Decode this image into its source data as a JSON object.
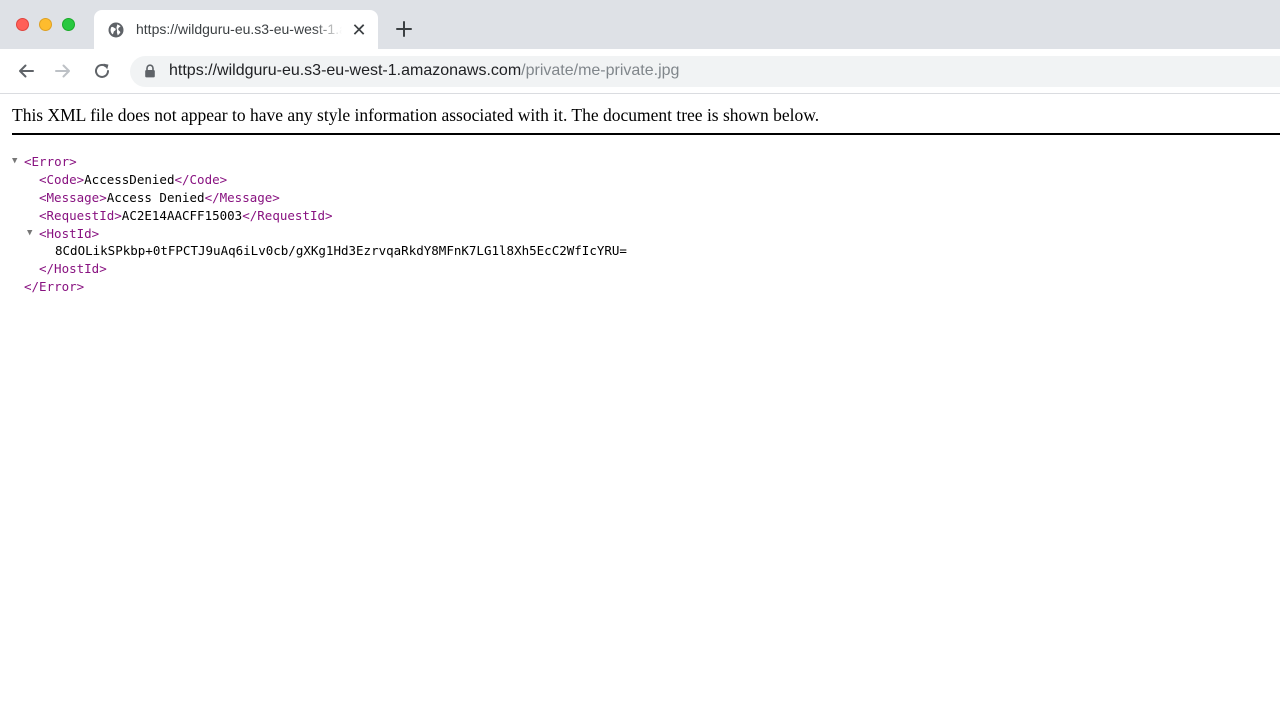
{
  "browser": {
    "tab": {
      "title": "https://wildguru-eu.s3-eu-west-1.amazonaws.com/private/me-private.jpg",
      "favicon": "globe-icon",
      "close_glyph": "✕"
    },
    "newtab_icon": "plus-icon",
    "address": {
      "url_host": "https://wildguru-eu.s3-eu-west-1.amazonaws.com",
      "url_path": "/private/me-private.jpg",
      "lock_icon": "lock-icon"
    },
    "colors": {
      "tabstrip": "#dee1e6",
      "omnibox": "#f1f3f4",
      "tag": "#881280"
    }
  },
  "page": {
    "notice": "This XML file does not appear to have any style information associated with it. The document tree is shown below.",
    "tree": {
      "error_open": "<Error>",
      "error_close": "</Error>",
      "code_open": "<Code>",
      "code_value": "AccessDenied",
      "code_close": "</Code>",
      "message_open": "<Message>",
      "message_value": "Access Denied",
      "message_close": "</Message>",
      "requestid_open": "<RequestId>",
      "requestid_value": "AC2E14AACFF15003",
      "requestid_close": "</RequestId>",
      "hostid_open": "<HostId>",
      "hostid_value": "8CdOLikSPkbp+0tFPCTJ9uAq6iLv0cb/gXKg1Hd3EzrvqaRkdY8MFnK7LG1l8Xh5EcC2WfIcYRU=",
      "hostid_close": "</HostId>",
      "collapse_arrow": "▼"
    }
  }
}
